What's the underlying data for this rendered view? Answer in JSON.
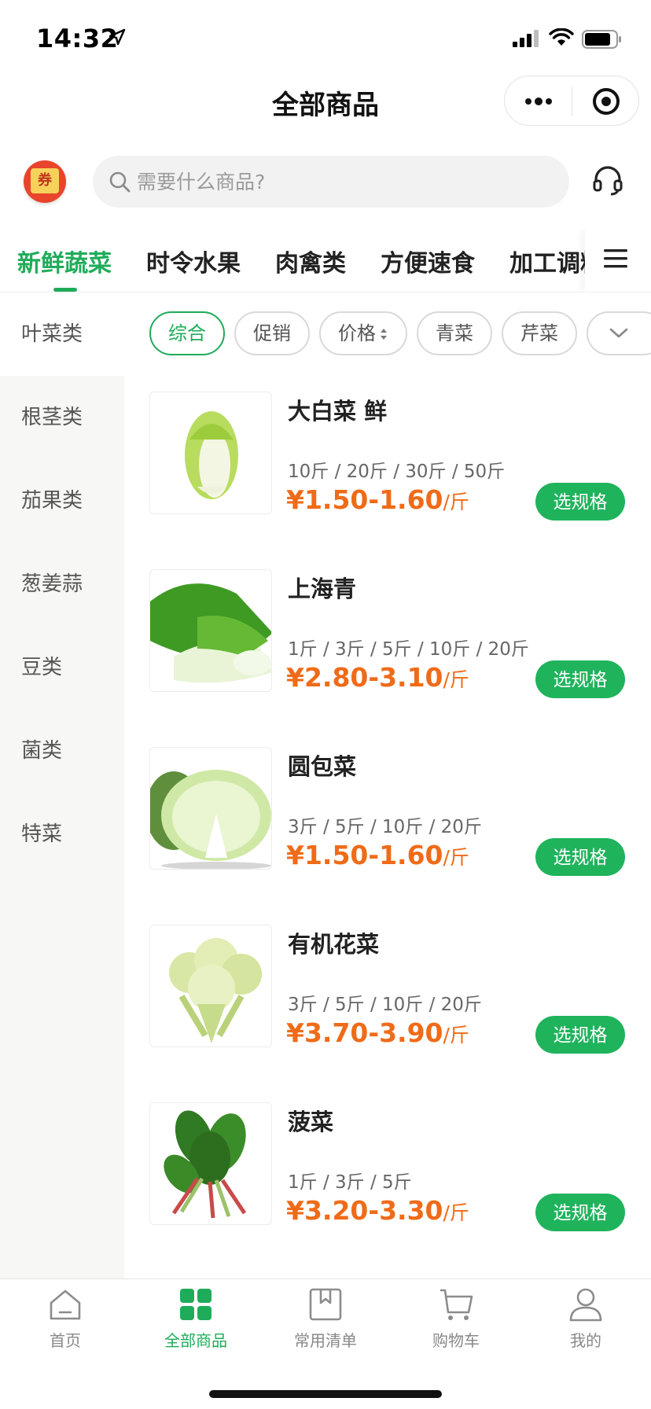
{
  "status_bar": {
    "time": "14:32"
  },
  "nav": {
    "title": "全部商品"
  },
  "coupon": {
    "label": "券"
  },
  "search": {
    "placeholder": "需要什么商品?"
  },
  "categories": [
    {
      "label": "新鲜蔬菜",
      "active": true
    },
    {
      "label": "时令水果"
    },
    {
      "label": "肉禽类"
    },
    {
      "label": "方便速食"
    },
    {
      "label": "加工调料"
    }
  ],
  "sidebar": {
    "items": [
      {
        "label": "叶菜类",
        "active": true
      },
      {
        "label": "根茎类"
      },
      {
        "label": "茄果类"
      },
      {
        "label": "葱姜蒜"
      },
      {
        "label": "豆类"
      },
      {
        "label": "菌类"
      },
      {
        "label": "特菜"
      }
    ]
  },
  "filters": [
    {
      "label": "综合",
      "active": true
    },
    {
      "label": "促销"
    },
    {
      "label": "价格"
    },
    {
      "label": "青菜"
    },
    {
      "label": "芹菜"
    }
  ],
  "products": [
    {
      "name": "大白菜 鲜",
      "specs": "10斤 / 20斤 / 30斤 / 50斤",
      "price": "¥1.50-1.60",
      "unit": "/斤",
      "button": "选规格",
      "image_icon": "napa-cabbage"
    },
    {
      "name": "上海青",
      "specs": "1斤 / 3斤 / 5斤 / 10斤 / 20斤",
      "price": "¥2.80-3.10",
      "unit": "/斤",
      "button": "选规格",
      "image_icon": "bok-choy"
    },
    {
      "name": "圆包菜",
      "specs": "3斤 / 5斤 / 10斤 / 20斤",
      "price": "¥1.50-1.60",
      "unit": "/斤",
      "button": "选规格",
      "image_icon": "cabbage"
    },
    {
      "name": "有机花菜",
      "specs": "3斤 / 5斤 / 10斤 / 20斤",
      "price": "¥3.70-3.90",
      "unit": "/斤",
      "button": "选规格",
      "image_icon": "cauliflower"
    },
    {
      "name": "菠菜",
      "specs": "1斤 / 3斤 / 5斤",
      "price": "¥3.20-3.30",
      "unit": "/斤",
      "button": "选规格",
      "image_icon": "spinach"
    }
  ],
  "tabbar": [
    {
      "label": "首页",
      "icon": "home-icon"
    },
    {
      "label": "全部商品",
      "icon": "grid-icon",
      "active": true
    },
    {
      "label": "常用清单",
      "icon": "bookmark-list-icon"
    },
    {
      "label": "购物车",
      "icon": "cart-icon"
    },
    {
      "label": "我的",
      "icon": "user-icon"
    }
  ],
  "colors": {
    "accent": "#1fac5a",
    "price": "#f06b18",
    "sidebar_bg": "#f7f7f5"
  }
}
